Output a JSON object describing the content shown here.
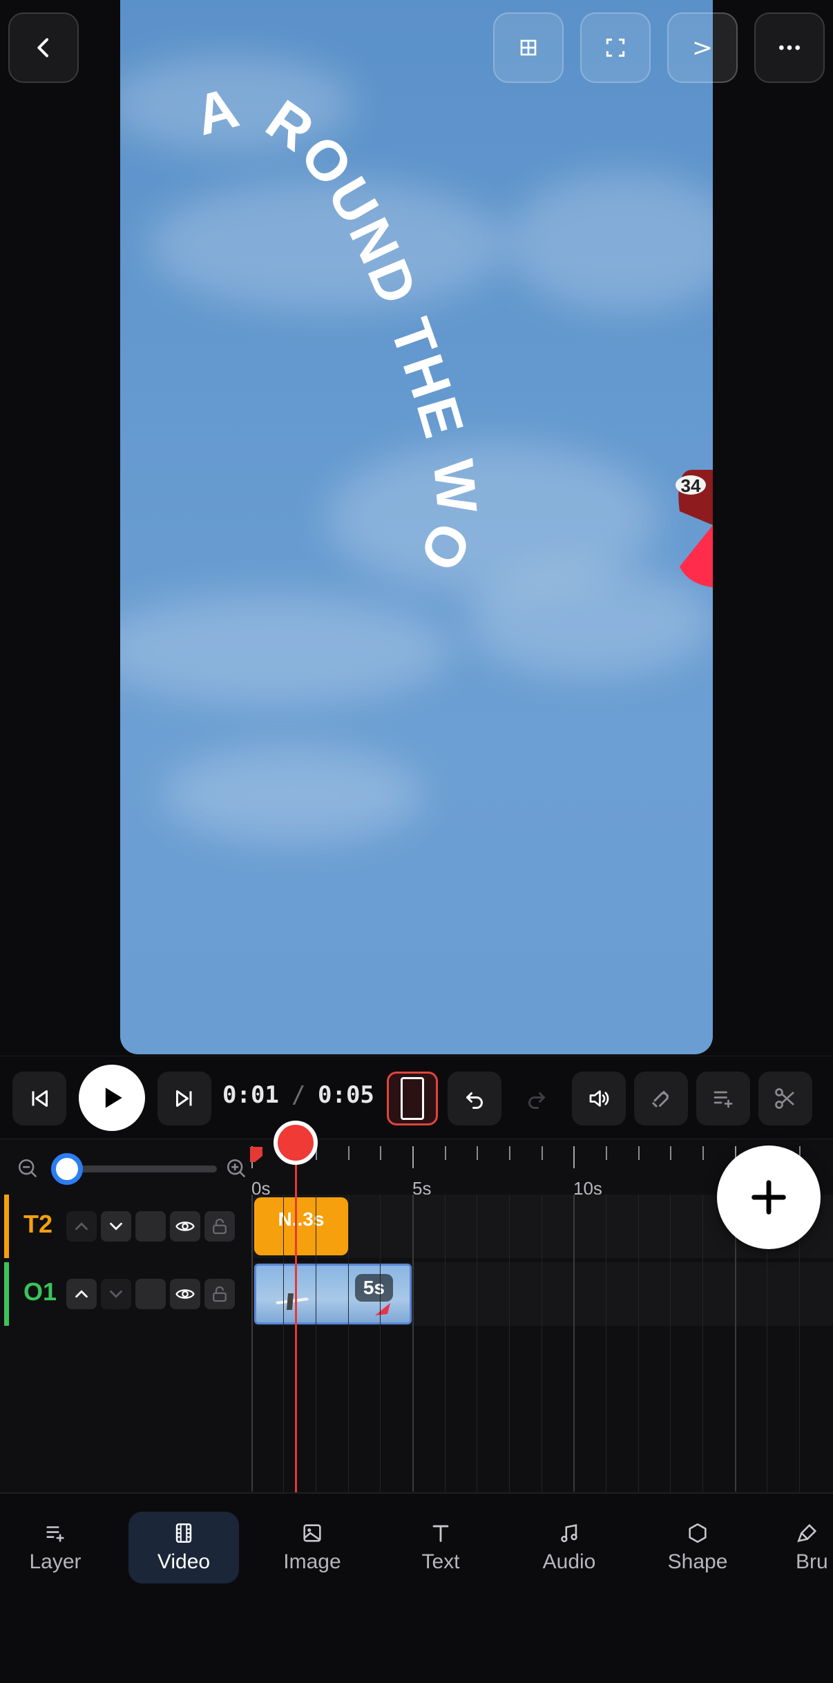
{
  "canvas": {
    "overlay_text": "A ROUND THE WOR",
    "plane_number": "34"
  },
  "top_bar": {
    "next_glyph": ">"
  },
  "transport": {
    "current_time": "0:01",
    "separator": "/",
    "total_time": "0:05"
  },
  "timeline": {
    "ruler_labels": [
      "0s",
      "5s",
      "10s"
    ],
    "tracks": [
      {
        "name": "T2",
        "color": "#f5a00c",
        "clip_label": "N..3s"
      },
      {
        "name": "O1",
        "color": "#3ac45a",
        "clip_label": "5s"
      }
    ]
  },
  "bottom_nav": {
    "items": [
      {
        "label": "Layer",
        "icon": "layer-icon"
      },
      {
        "label": "Video",
        "icon": "film-icon"
      },
      {
        "label": "Image",
        "icon": "image-icon"
      },
      {
        "label": "Text",
        "icon": "text-icon"
      },
      {
        "label": "Audio",
        "icon": "music-note-icon"
      },
      {
        "label": "Shape",
        "icon": "hexagon-icon"
      },
      {
        "label": "Bru",
        "icon": "brush-icon"
      }
    ],
    "active": "Video"
  },
  "colors": {
    "accent_red": "#e53935",
    "accent_blue": "#2b7df2",
    "text_track": "#f5a00c",
    "video_track": "#3ac45a"
  }
}
